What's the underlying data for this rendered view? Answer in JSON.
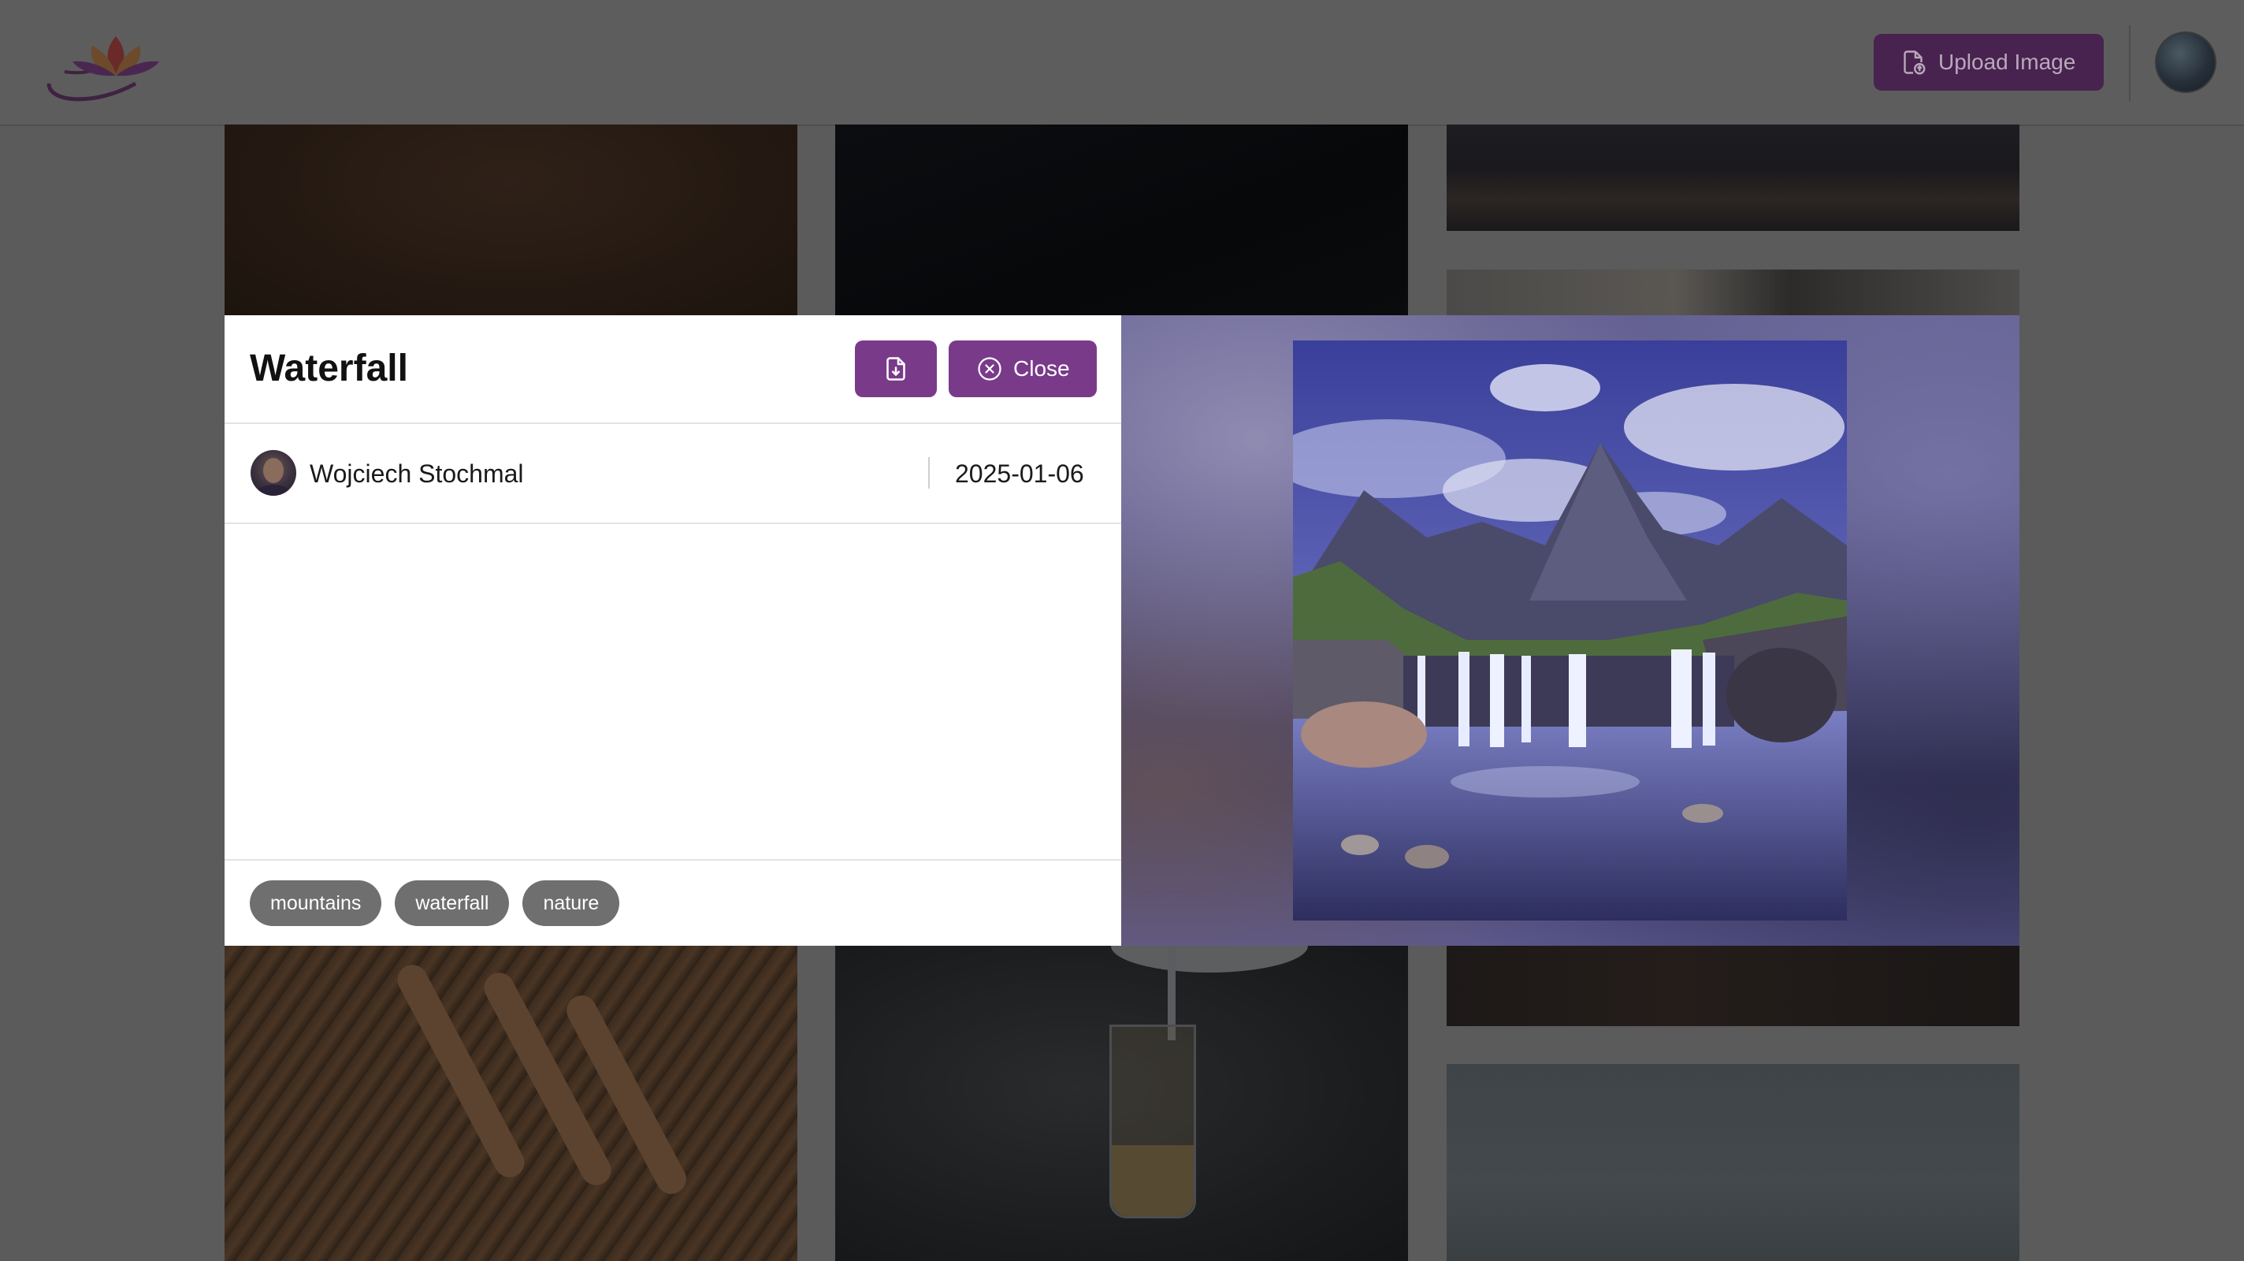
{
  "header": {
    "upload_label": "Upload Image"
  },
  "modal": {
    "title": "Waterfall",
    "close_label": "Close",
    "author": "Wojciech Stochmal",
    "date": "2025-01-06",
    "tags": [
      "mountains",
      "waterfall",
      "nature"
    ]
  },
  "colors": {
    "accent": "#7a3a8a",
    "tag_bg": "#6f6f6f",
    "overlay": "#5b5b5b"
  },
  "icons": [
    "lotus-logo",
    "upload-file-icon",
    "download-file-icon",
    "close-circle-icon"
  ]
}
